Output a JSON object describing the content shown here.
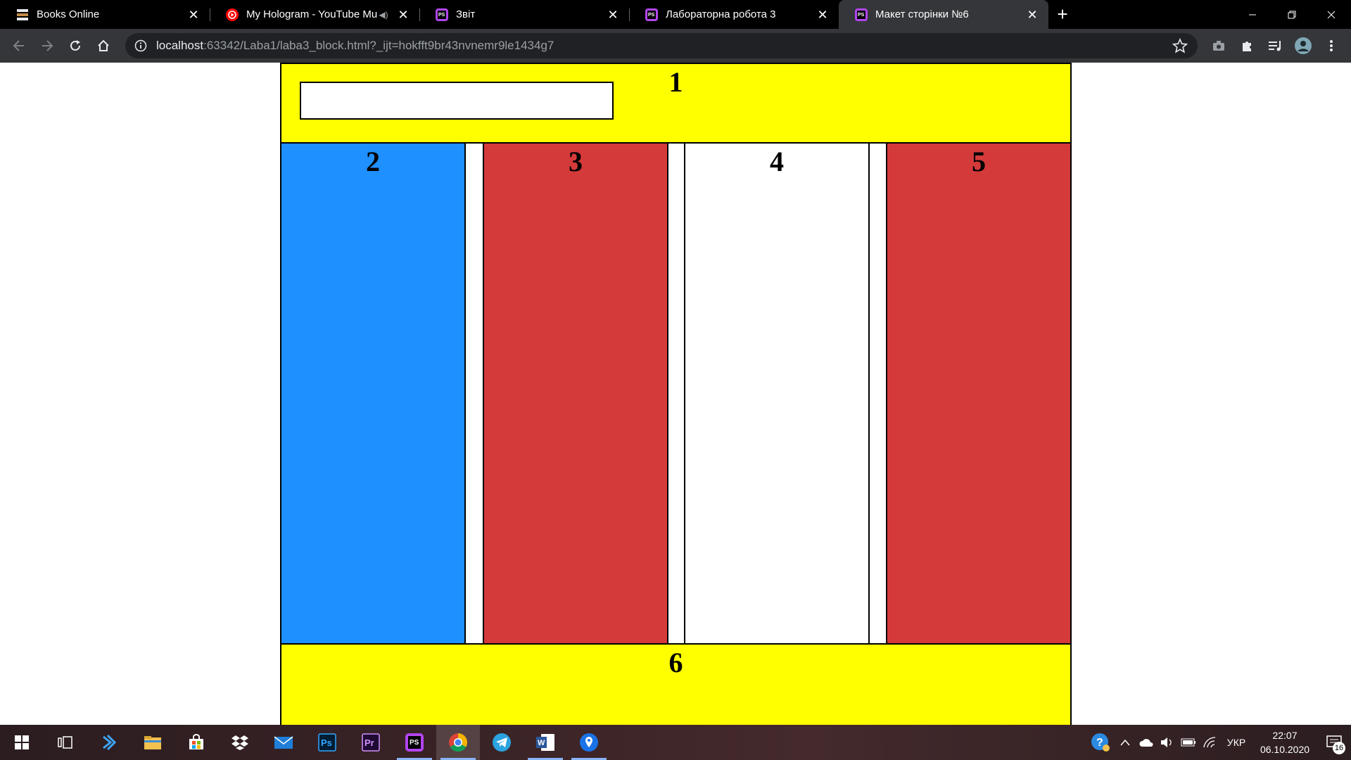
{
  "tabs": [
    {
      "title": "Books Online",
      "icon": "books-icon",
      "active": false
    },
    {
      "title": "My Hologram - YouTube Mu",
      "icon": "youtube-music-icon",
      "audio": true,
      "active": false
    },
    {
      "title": "Звіт",
      "icon": "phpstorm-icon",
      "active": false
    },
    {
      "title": "Лабораторна робота 3",
      "icon": "phpstorm-icon",
      "active": false
    },
    {
      "title": "Макет сторінки №6",
      "icon": "phpstorm-icon",
      "active": true
    }
  ],
  "address": {
    "host": "localhost",
    "rest": ":63342/Laba1/laba3_block.html?_ijt=hokfft9br43nvnemr9le1434g7"
  },
  "page": {
    "block1": "1",
    "block2": "2",
    "block3": "3",
    "block4": "4",
    "block5": "5",
    "block6": "6",
    "input_value": "",
    "colors": {
      "yellow": "#ffff00",
      "blue": "#1e90ff",
      "red": "#d53a3a",
      "white": "#ffffff"
    }
  },
  "taskbar": {
    "apps": [
      "windows-start-icon",
      "task-view-icon",
      "visual-studio-code-icon",
      "file-explorer-icon",
      "microsoft-store-icon",
      "dropbox-icon",
      "mail-icon",
      "photoshop-icon",
      "premiere-pro-icon",
      "phpstorm-icon",
      "chrome-icon",
      "telegram-icon",
      "word-icon",
      "maps-icon"
    ],
    "ps_label": "Ps",
    "pr_label": "Pr",
    "phpstorm_label": "PS",
    "word_label": "W",
    "language": "УКР",
    "time": "22:07",
    "date": "06.10.2020",
    "notification_count": "16"
  }
}
